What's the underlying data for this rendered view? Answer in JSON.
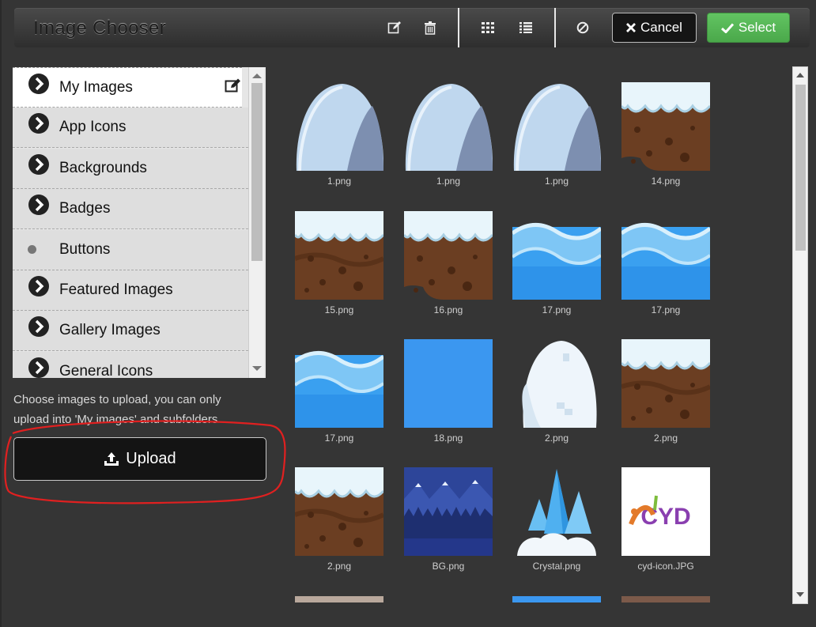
{
  "header": {
    "title": "Image Chooser",
    "cancel_label": "Cancel",
    "select_label": "Select"
  },
  "colors": {
    "select_green": "#5cb85c",
    "annotation_red": "#e02020",
    "water_blue": "#3aa0f0",
    "soil_brown": "#6b3e22"
  },
  "sidebar": {
    "folders": [
      {
        "label": "My Images",
        "icon": "chevron-right-circle-icon",
        "active": true
      },
      {
        "label": "App Icons",
        "icon": "chevron-right-circle-icon"
      },
      {
        "label": "Backgrounds",
        "icon": "chevron-right-circle-icon"
      },
      {
        "label": "Badges",
        "icon": "chevron-right-circle-icon"
      },
      {
        "label": "Buttons",
        "icon": "dot-icon"
      },
      {
        "label": "Featured Images",
        "icon": "chevron-right-circle-icon"
      },
      {
        "label": "Gallery Images",
        "icon": "chevron-right-circle-icon"
      },
      {
        "label": "General Icons",
        "icon": "chevron-right-circle-icon"
      }
    ],
    "hint": "Choose images to upload, you can only upload into 'My images' and subfolders",
    "upload_label": "Upload"
  },
  "images": [
    {
      "name": "1.png",
      "kind": "ice"
    },
    {
      "name": "1.png",
      "kind": "ice"
    },
    {
      "name": "1.png",
      "kind": "ice"
    },
    {
      "name": "14.png",
      "kind": "ground-corner"
    },
    {
      "name": "15.png",
      "kind": "ground"
    },
    {
      "name": "16.png",
      "kind": "ground-corner"
    },
    {
      "name": "17.png",
      "kind": "water"
    },
    {
      "name": "17.png",
      "kind": "water"
    },
    {
      "name": "17.png",
      "kind": "water"
    },
    {
      "name": "18.png",
      "kind": "blue"
    },
    {
      "name": "2.png",
      "kind": "igloo"
    },
    {
      "name": "2.png",
      "kind": "ground"
    },
    {
      "name": "2.png",
      "kind": "ground"
    },
    {
      "name": "BG.png",
      "kind": "bg"
    },
    {
      "name": "Crystal.png",
      "kind": "crystal"
    },
    {
      "name": "cyd-icon.JPG",
      "kind": "cyd",
      "logo_text": "CYD"
    }
  ]
}
